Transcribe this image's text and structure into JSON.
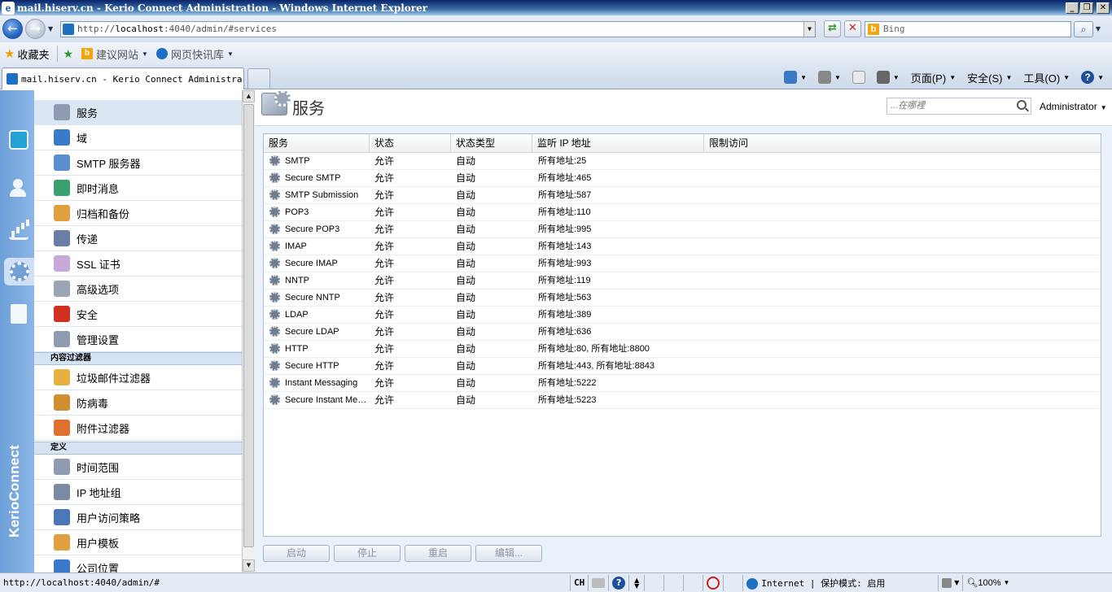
{
  "window": {
    "title": "mail.hiserv.cn - Kerio Connect Administration - Windows Internet Explorer",
    "ie_icon_letter": "e",
    "controls": {
      "minimize": "_",
      "maximize": "❐",
      "close": "✕"
    }
  },
  "browser": {
    "url_prefix": "http://",
    "url_host": "localhost",
    "url_rest": ":4040/admin/#services",
    "search_placeholder": "Bing",
    "favorites_label": "收藏夹",
    "fav_links": [
      "建议网站",
      "网页快讯库"
    ],
    "tab_title": "mail.hiserv.cn - Kerio Connect Administra...",
    "commands": {
      "page": "页面(P)",
      "safety": "安全(S)",
      "tools": "工具(O)"
    }
  },
  "app": {
    "brand": "KerioConnect",
    "rail": [
      {
        "name": "email-icon",
        "active": false
      },
      {
        "name": "users-icon",
        "active": false
      },
      {
        "name": "statistics-icon",
        "active": false
      },
      {
        "name": "configuration-icon",
        "active": true
      },
      {
        "name": "logs-icon",
        "active": false
      }
    ],
    "nav_items": [
      {
        "label": "服务",
        "icon": "services-icon",
        "selected": true,
        "color": "#8e9bb0"
      },
      {
        "label": "域",
        "icon": "domain-icon",
        "selected": false,
        "color": "#3a7ac8"
      },
      {
        "label": "SMTP 服务器",
        "icon": "smtp-server-icon",
        "selected": false,
        "color": "#5a8fd0"
      },
      {
        "label": "即时消息",
        "icon": "instant-messaging-icon",
        "selected": false,
        "color": "#3aa070"
      },
      {
        "label": "归档和备份",
        "icon": "archive-backup-icon",
        "selected": false,
        "color": "#e0a040"
      },
      {
        "label": "传递",
        "icon": "delivery-icon",
        "selected": false,
        "color": "#6a7fa8"
      },
      {
        "label": "SSL 证书",
        "icon": "ssl-certificate-icon",
        "selected": false,
        "color": "#c8a8d8"
      },
      {
        "label": "高级选项",
        "icon": "advanced-options-icon",
        "selected": false,
        "color": "#9aa6b6"
      },
      {
        "label": "安全",
        "icon": "security-icon",
        "selected": false,
        "color": "#d03020"
      },
      {
        "label": "管理设置",
        "icon": "admin-settings-icon",
        "selected": false,
        "color": "#8e9bb0"
      }
    ],
    "section_content_filter": "内容过滤器",
    "filter_items": [
      {
        "label": "垃圾邮件过滤器",
        "icon": "spam-filter-icon",
        "color": "#e8b040"
      },
      {
        "label": "防病毒",
        "icon": "antivirus-icon",
        "color": "#d09030"
      },
      {
        "label": "附件过滤器",
        "icon": "attachment-filter-icon",
        "color": "#e07030"
      }
    ],
    "section_definitions": "定义",
    "definition_items": [
      {
        "label": "时间范围",
        "icon": "time-range-icon",
        "color": "#8e9bb0"
      },
      {
        "label": "IP 地址组",
        "icon": "ip-address-group-icon",
        "color": "#7a8aa0"
      },
      {
        "label": "用户访问策略",
        "icon": "user-access-policy-icon",
        "color": "#4a78b8"
      },
      {
        "label": "用户模板",
        "icon": "user-template-icon",
        "color": "#e0a040"
      },
      {
        "label": "公司位置",
        "icon": "company-location-icon",
        "color": "#3a78c8"
      }
    ],
    "page_title": "服务",
    "finder_placeholder": "...在哪裡",
    "user": "Administrator",
    "grid_headers": [
      "服务",
      "状态",
      "状态类型",
      "监听 IP 地址",
      "限制访问"
    ],
    "services": [
      {
        "name": "SMTP",
        "state": "允许",
        "type": "自动",
        "address": "所有地址:25",
        "limit": ""
      },
      {
        "name": "Secure SMTP",
        "state": "允许",
        "type": "自动",
        "address": "所有地址:465",
        "limit": ""
      },
      {
        "name": "SMTP Submission",
        "state": "允许",
        "type": "自动",
        "address": "所有地址:587",
        "limit": ""
      },
      {
        "name": "POP3",
        "state": "允许",
        "type": "自动",
        "address": "所有地址:110",
        "limit": ""
      },
      {
        "name": "Secure POP3",
        "state": "允许",
        "type": "自动",
        "address": "所有地址:995",
        "limit": ""
      },
      {
        "name": "IMAP",
        "state": "允许",
        "type": "自动",
        "address": "所有地址:143",
        "limit": ""
      },
      {
        "name": "Secure IMAP",
        "state": "允许",
        "type": "自动",
        "address": "所有地址:993",
        "limit": ""
      },
      {
        "name": "NNTP",
        "state": "允许",
        "type": "自动",
        "address": "所有地址:119",
        "limit": ""
      },
      {
        "name": "Secure NNTP",
        "state": "允许",
        "type": "自动",
        "address": "所有地址:563",
        "limit": ""
      },
      {
        "name": "LDAP",
        "state": "允许",
        "type": "自动",
        "address": "所有地址:389",
        "limit": ""
      },
      {
        "name": "Secure LDAP",
        "state": "允许",
        "type": "自动",
        "address": "所有地址:636",
        "limit": ""
      },
      {
        "name": "HTTP",
        "state": "允许",
        "type": "自动",
        "address": "所有地址:80, 所有地址:8800",
        "limit": ""
      },
      {
        "name": "Secure HTTP",
        "state": "允许",
        "type": "自动",
        "address": "所有地址:443, 所有地址:8843",
        "limit": ""
      },
      {
        "name": "Instant Messaging",
        "state": "允许",
        "type": "自动",
        "address": "所有地址:5222",
        "limit": ""
      },
      {
        "name": "Secure Instant Messaging",
        "state": "允许",
        "type": "自动",
        "address": "所有地址:5223",
        "limit": ""
      }
    ],
    "actions": [
      "启动",
      "停止",
      "重启",
      "编辑..."
    ]
  },
  "statusbar": {
    "url": "http://localhost:4040/admin/#",
    "lang": "CH",
    "zone": "Internet | 保护模式: 启用",
    "zoom": "100%"
  }
}
